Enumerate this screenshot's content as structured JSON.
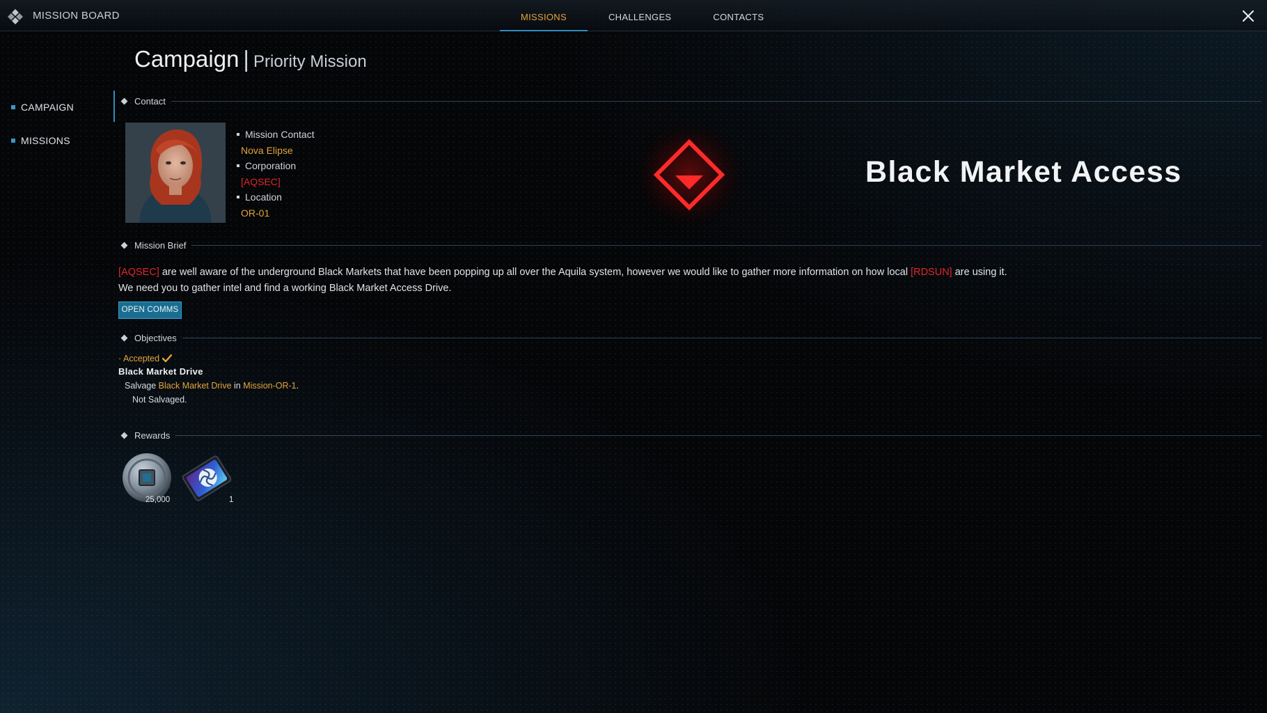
{
  "topbar": {
    "title": "MISSION BOARD",
    "tabs": [
      {
        "label": "MISSIONS",
        "active": true
      },
      {
        "label": "CHALLENGES",
        "active": false
      },
      {
        "label": "CONTACTS",
        "active": false
      }
    ],
    "logo_icon": "diamond-cluster-icon",
    "close_icon": "close-icon"
  },
  "header": {
    "title": "Campaign",
    "separator": "|",
    "subtitle": "Priority Mission"
  },
  "sidebar": {
    "items": [
      {
        "label": "CAMPAIGN",
        "selected": true
      },
      {
        "label": "MISSIONS",
        "selected": false
      }
    ]
  },
  "contact": {
    "section_label": "Contact",
    "mission_contact_label": "Mission Contact",
    "mission_contact_value": "Nova Elipse",
    "corporation_label": "Corporation",
    "corporation_value": "[AQSEC]",
    "location_label": "Location",
    "location_value": "OR-01",
    "emblem_icon": "red-diamond-emblem-icon"
  },
  "mission": {
    "name": "Black Market Access"
  },
  "brief": {
    "section_label": "Mission Brief",
    "tag1": "[AQSEC]",
    "text1": " are well aware of the underground Black Markets that have been popping up all over the Aquila system, however we would like to gather more information on how local ",
    "tag2": "[RDSUN]",
    "text2": " are using it.",
    "text3": "We need you to gather intel and find a working Black Market Access Drive.",
    "button_label": "OPEN COMMS"
  },
  "objectives": {
    "section_label": "Objectives",
    "status": "· Accepted",
    "title": "Black Market Drive",
    "line1_prefix": "Salvage ",
    "line1_item": "Black Market Drive",
    "line1_mid": " in ",
    "line1_place": "Mission-OR-1",
    "line1_suffix": ".",
    "line2": "Not Salvaged."
  },
  "rewards": {
    "section_label": "Rewards",
    "items": [
      {
        "icon": "credits-coin-icon",
        "count": "25,000"
      },
      {
        "icon": "blueprint-card-icon",
        "count": "1"
      }
    ]
  },
  "colors": {
    "accent_orange": "#e3a43c",
    "accent_red": "#e0262a",
    "accent_blue": "#2f8ec2",
    "button_bg": "#1a6d90"
  }
}
